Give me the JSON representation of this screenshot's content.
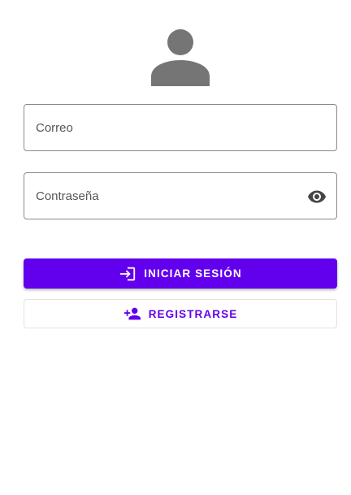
{
  "login_form": {
    "email_placeholder": "Correo",
    "password_placeholder": "Contraseña",
    "login_button_label": "INICIAR SESIÓN",
    "register_button_label": "REGISTRARSE"
  },
  "icons": {
    "avatar": "person-icon",
    "password_toggle": "eye-icon",
    "login": "login-icon",
    "register": "person-add-icon"
  },
  "colors": {
    "primary": "#6200ee",
    "avatar": "#757575",
    "field_border": "#8a8a8a"
  }
}
